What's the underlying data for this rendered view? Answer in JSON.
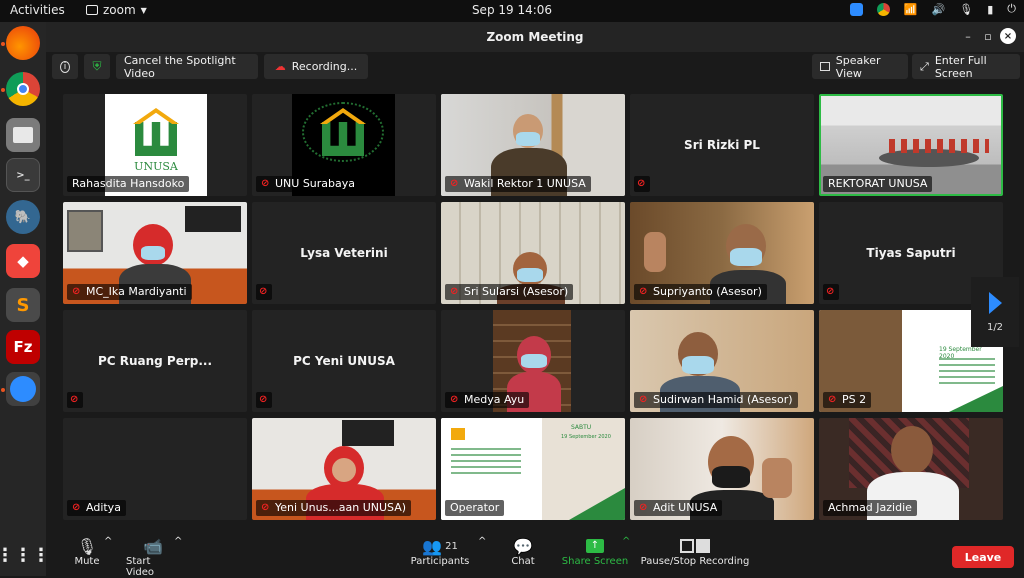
{
  "topbar": {
    "activities": "Activities",
    "app_name": "zoom",
    "clock": "Sep 19  14:06"
  },
  "dock": {
    "items": [
      "firefox-icon",
      "chrome-icon",
      "files-icon",
      "terminal-icon",
      "pgadmin-icon",
      "anydesk-icon",
      "sublime-icon",
      "filezilla-icon",
      "zoom-icon"
    ]
  },
  "window": {
    "title": "Zoom Meeting"
  },
  "toolbar_top": {
    "cancel_spotlight": "Cancel the Spotlight Video",
    "recording": "Recording...",
    "speaker_view": "Speaker View",
    "full_screen": "Enter Full Screen"
  },
  "tiles": [
    {
      "name": "Rahasdita Hansdoko",
      "muted": false,
      "kind": "logo-white"
    },
    {
      "name": "UNU Surabaya",
      "muted": true,
      "kind": "logo-black"
    },
    {
      "name": "Wakil Rektor 1 UNUSA",
      "muted": true,
      "kind": "video"
    },
    {
      "name": "Sri Rizki PL",
      "muted": true,
      "kind": "name-only"
    },
    {
      "name": "REKTORAT UNUSA",
      "muted": false,
      "kind": "room",
      "active": true
    },
    {
      "name": "MC_Ika Mardiyanti",
      "muted": true,
      "kind": "video"
    },
    {
      "name": "Lysa Veterini",
      "muted": true,
      "kind": "name-only"
    },
    {
      "name": "Sri Sularsi (Asesor)",
      "muted": true,
      "kind": "video"
    },
    {
      "name": "Supriyanto (Asesor)",
      "muted": true,
      "kind": "video"
    },
    {
      "name": "Tiyas Saputri",
      "muted": true,
      "kind": "name-only"
    },
    {
      "name": "PC Ruang Perp...",
      "muted": true,
      "kind": "name-only"
    },
    {
      "name": "PC Yeni UNUSA",
      "muted": true,
      "kind": "name-only"
    },
    {
      "name": "Medya Ayu",
      "muted": true,
      "kind": "video"
    },
    {
      "name": "Sudirwan Hamid (Asesor)",
      "muted": true,
      "kind": "video"
    },
    {
      "name": "PS 2",
      "muted": true,
      "kind": "slide"
    },
    {
      "name": "Aditya",
      "muted": true,
      "kind": "name-only"
    },
    {
      "name": "Yeni Unus...aan UNUSA)",
      "muted": true,
      "kind": "video"
    },
    {
      "name": "Operator",
      "muted": false,
      "kind": "slide"
    },
    {
      "name": "Adit UNUSA",
      "muted": true,
      "kind": "video"
    },
    {
      "name": "Achmad Jazidie",
      "muted": false,
      "kind": "video"
    }
  ],
  "tile_texts": {
    "unusa_logo_text": "UNUSA",
    "slide_date": "19 September 2020",
    "slide_day": "SABTU"
  },
  "pager": {
    "page": "1/2"
  },
  "controls": {
    "mute": "Mute",
    "start_video": "Start Video",
    "participants": "Participants",
    "participants_count": "21",
    "chat": "Chat",
    "share_screen": "Share Screen",
    "pause_recording": "Pause/Stop Recording",
    "leave": "Leave"
  },
  "colors": {
    "accent_blue": "#2d8cff",
    "share_green": "#2dbb45",
    "leave_red": "#e02828",
    "muted_red": "#e22222"
  }
}
